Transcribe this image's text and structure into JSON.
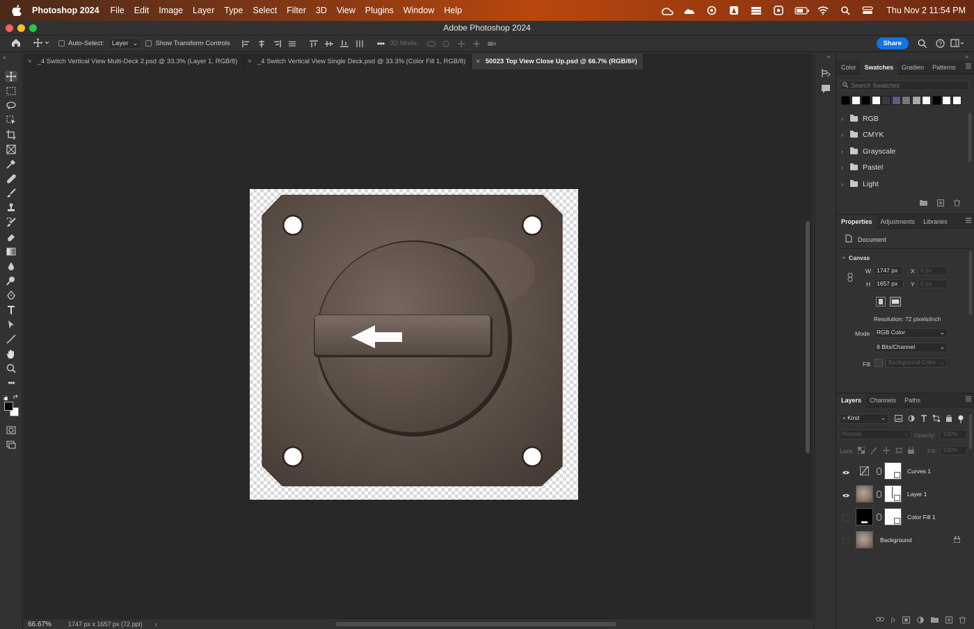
{
  "menubar": {
    "app_name": "Photoshop 2024",
    "menus": [
      "File",
      "Edit",
      "Image",
      "Layer",
      "Type",
      "Select",
      "Filter",
      "3D",
      "View",
      "Plugins",
      "Window",
      "Help"
    ],
    "clock": "Thu Nov 2  11:54 PM",
    "status_icons": [
      "creative-cloud-icon",
      "cloud-icon",
      "sync-icon",
      "adobe-icon",
      "stack-icon",
      "screen-icon",
      "battery-icon",
      "wifi-icon",
      "search-icon",
      "control-center-icon"
    ]
  },
  "window": {
    "title": "Adobe Photoshop 2024"
  },
  "options_bar": {
    "auto_select_label": "Auto-Select:",
    "auto_select_value": "Layer",
    "show_transform_label": "Show Transform Controls",
    "mode_3d_label": "3D Mode:",
    "share_label": "Share"
  },
  "tabs": [
    {
      "label": "_4 Switch Vertical View Multi-Deck 2.psd @ 33.3% (Layer 1, RGB/8)",
      "active": false
    },
    {
      "label": "_4 Switch Vertical View Single Deck.psd @ 33.3% (Color Fill 1, RGB/8)",
      "active": false
    },
    {
      "label": "50023 Top View Close Up.psd @ 66.7% (RGB/8#)",
      "active": true
    }
  ],
  "tabs_close_glyph": "×",
  "status": {
    "zoom": "66.67%",
    "doc_info": "1747 px x 1657 px (72 ppi)",
    "arrow": "›"
  },
  "swatches_panel": {
    "tabs": [
      "Color",
      "Swatches",
      "Gradien",
      "Patterns"
    ],
    "active_tab": "Swatches",
    "search_placeholder": "Search Swatches",
    "recent_colors": [
      "#000000",
      "#ffffff",
      "#000000",
      "#ffffff",
      "#3a3a3a",
      "#5a5f7e",
      "#777777",
      "#a9a9a9",
      "#ffffff",
      "#000000",
      "#ffffff",
      "#ffffff"
    ],
    "groups": [
      "RGB",
      "CMYK",
      "Grayscale",
      "Pastel",
      "Light"
    ]
  },
  "properties_panel": {
    "tabs": [
      "Properties",
      "Adjustments",
      "Libraries"
    ],
    "active_tab": "Properties",
    "section_label": "Document",
    "canvas_label": "Canvas",
    "width_label": "W",
    "width_value": "1747 px",
    "height_label": "H",
    "height_value": "1657 px",
    "x_label": "X",
    "x_value": "0 px",
    "y_label": "Y",
    "y_value": "0 px",
    "resolution": "Resolution: 72 pixels/inch",
    "mode_label": "Mode",
    "mode_value": "RGB Color",
    "depth_value": "8 Bits/Channel",
    "fill_label": "Fill",
    "fill_value": "Background Color"
  },
  "layers_panel": {
    "tabs": [
      "Layers",
      "Channels",
      "Paths"
    ],
    "active_tab": "Layers",
    "filter_label": "Kind",
    "blend_mode": "Normal",
    "opacity_label": "Opacity:",
    "opacity_value": "100%",
    "lock_label": "Lock:",
    "fill_label": "Fill:",
    "fill_value": "100%",
    "layers": [
      {
        "name": "Curves 1",
        "visible": true
      },
      {
        "name": "Layer 1",
        "visible": true
      },
      {
        "name": "Color Fill 1",
        "visible": false
      },
      {
        "name": "Background",
        "visible": false,
        "locked": true
      }
    ]
  },
  "colors": {
    "accent": "#1473e6",
    "foreground": "#000000",
    "background": "#ffffff",
    "plate": "#5e5149"
  }
}
